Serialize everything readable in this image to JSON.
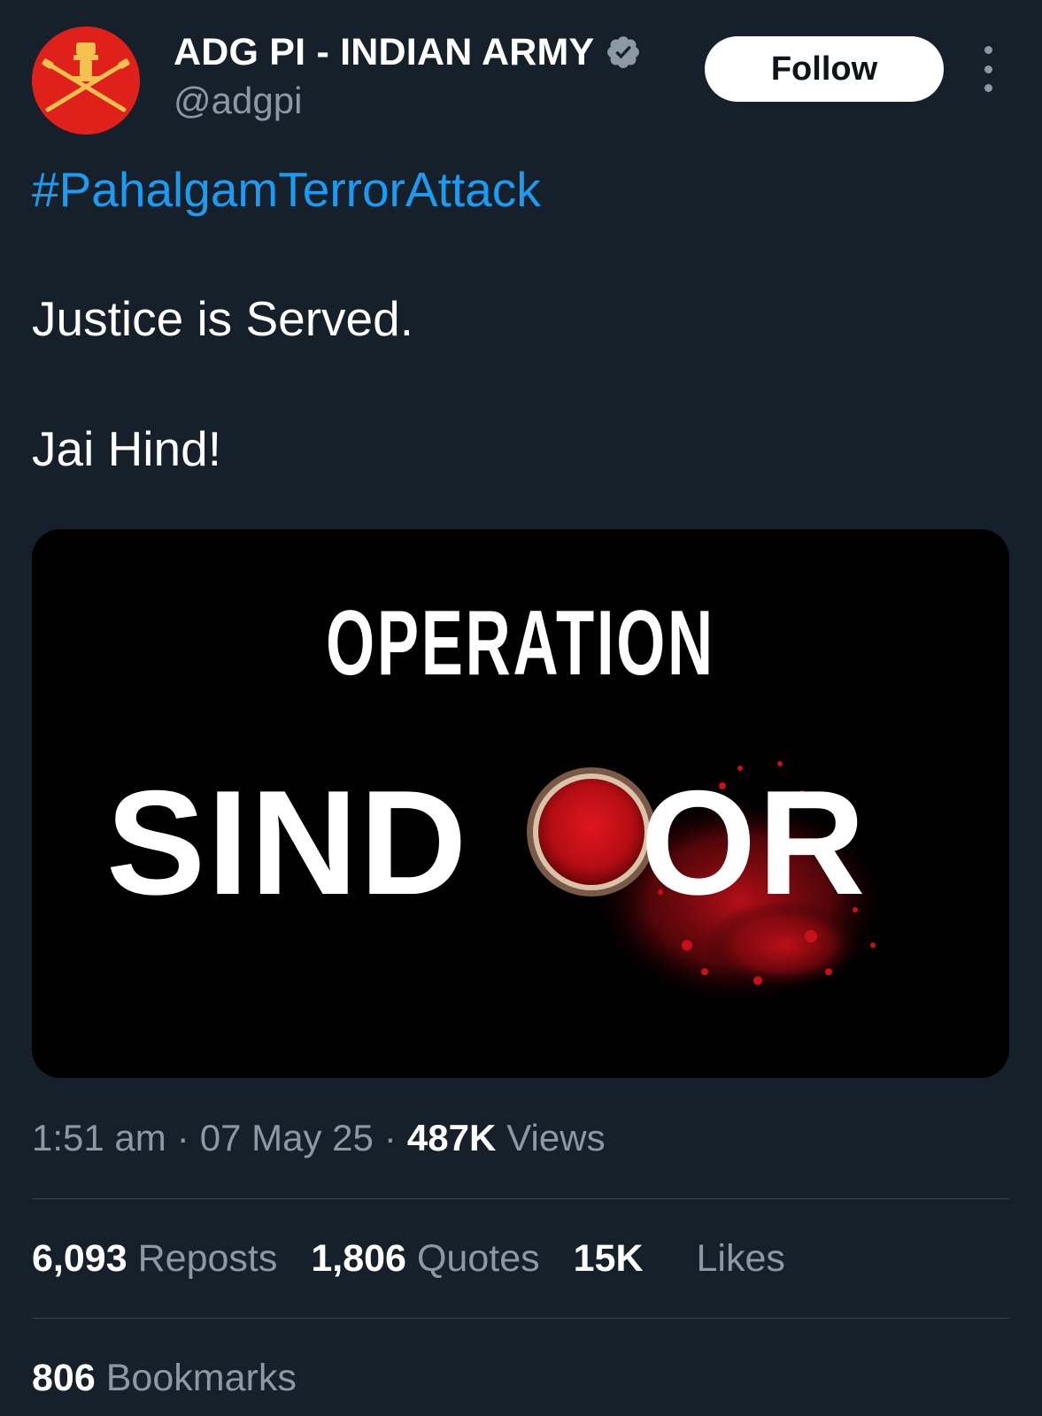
{
  "author": {
    "display_name": "ADG PI - INDIAN ARMY",
    "handle": "@adgpi",
    "verified_icon": "verified-badge-icon",
    "avatar_icon": "indian-army-emblem",
    "avatar_color": "#e0201a"
  },
  "actions": {
    "follow_label": "Follow",
    "more_icon": "vertical-ellipsis-icon"
  },
  "tweet": {
    "hashtag": "#PahalgamTerrorAttack",
    "line1": "Justice is Served.",
    "line2": "Jai Hind!"
  },
  "media": {
    "title": "OPERATION",
    "subtitle_left": "SIND",
    "subtitle_right": "OR",
    "accent_color": "#c8101a"
  },
  "meta": {
    "time": "1:51 am",
    "separator": "·",
    "date": "07 May 25",
    "views_count": "487K",
    "views_label": "Views"
  },
  "stats": {
    "reposts_count": "6,093",
    "reposts_label": "Reposts",
    "quotes_count": "1,806",
    "quotes_label": "Quotes",
    "likes_count": "15K",
    "likes_label": "Likes",
    "bookmarks_count": "806",
    "bookmarks_label": "Bookmarks"
  },
  "colors": {
    "background": "#15202b",
    "link": "#1d9bf0",
    "secondary_text": "#8b98a5",
    "divider": "#38444d"
  }
}
